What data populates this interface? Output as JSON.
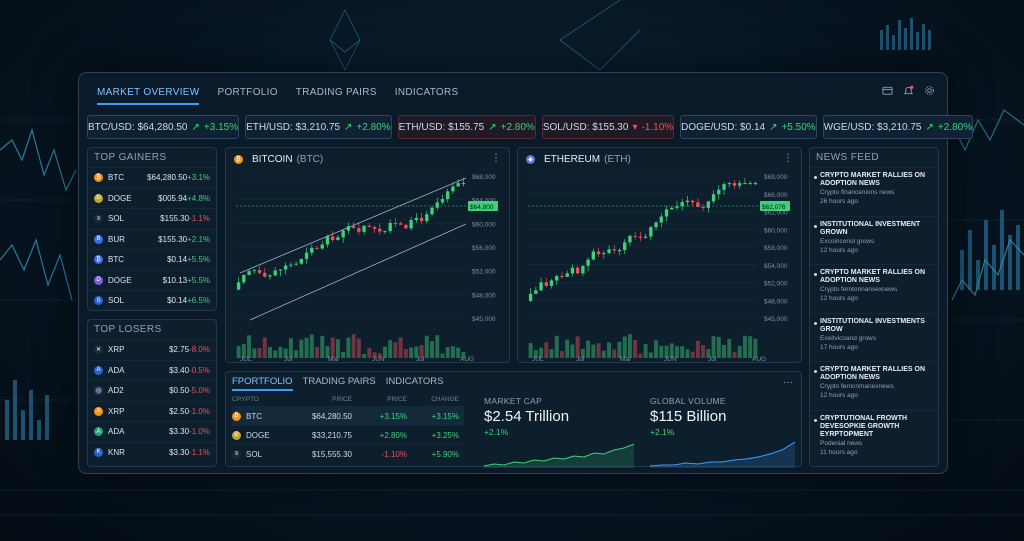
{
  "nav": {
    "tabs": [
      "MARKET OVERVIEW",
      "PORTFOLIO",
      "TRADING PAIRS",
      "INDICATORS"
    ],
    "icons": [
      "wallet-icon",
      "bell-icon",
      "gear-icon"
    ]
  },
  "tickers": [
    {
      "pair": "BTC/USD: $64,280.50",
      "change": "+3.15%",
      "direction": "up"
    },
    {
      "pair": "ETH/USD: $3,210.75",
      "change": "+2.80%",
      "direction": "up"
    },
    {
      "pair": "ETH/USD: $155.75",
      "change": "+2.80%",
      "direction": "up"
    },
    {
      "pair": "SOL/USD: $155.30",
      "change": "-1.10%",
      "direction": "down"
    },
    {
      "pair": "DOGE/USD: $0.14",
      "change": "+5.50%",
      "direction": "up"
    },
    {
      "pair": "WGE/USD: $3,210.75",
      "change": "+2.80%",
      "direction": "up"
    }
  ],
  "top_gainers": {
    "title": "TOP GAINERS",
    "rows": [
      {
        "sym": "BTC",
        "price": "$64,280.50",
        "change": "+3.1%",
        "color": "#f7931a",
        "glyph": "₿"
      },
      {
        "sym": "DOGE",
        "price": "$005.94",
        "change": "+4.8%",
        "color": "#c2a633",
        "glyph": "Ð"
      },
      {
        "sym": "SOL",
        "price": "$155.30",
        "change": "-1.1%",
        "color": "#1e2a3a",
        "glyph": "≡"
      },
      {
        "sym": "BUR",
        "price": "$155.30",
        "change": "+2.1%",
        "color": "#3a6ee8",
        "glyph": "B"
      },
      {
        "sym": "BTC",
        "price": "$0.14",
        "change": "+5.5%",
        "color": "#3a6ee8",
        "glyph": "₿"
      },
      {
        "sym": "DOGE",
        "price": "$10.13",
        "change": "+5.5%",
        "color": "#7a5ae0",
        "glyph": "D"
      },
      {
        "sym": "SOL",
        "price": "$0.14",
        "change": "+6.5%",
        "color": "#2a62c8",
        "glyph": "S"
      }
    ]
  },
  "top_losers": {
    "title": "TOP LOSERS",
    "rows": [
      {
        "sym": "XRP",
        "price": "$2.75",
        "change": "-8.0%",
        "color": "#1e2a3a",
        "glyph": "✕"
      },
      {
        "sym": "ADA",
        "price": "$3.40",
        "change": "-0.5%",
        "color": "#2a62c8",
        "glyph": "A"
      },
      {
        "sym": "AD2",
        "price": "$0.50",
        "change": "-5.0%",
        "color": "#2a3a5a",
        "glyph": "◎"
      },
      {
        "sym": "XRP",
        "price": "$2.50",
        "change": "-1.0%",
        "color": "#f7931a",
        "glyph": "X"
      },
      {
        "sym": "ADA",
        "price": "$3.30",
        "change": "-1.0%",
        "color": "#26a17b",
        "glyph": "A"
      },
      {
        "sym": "KNR",
        "price": "$3.30",
        "change": "-1.1%",
        "color": "#2a62c8",
        "glyph": "K"
      }
    ]
  },
  "btc_chart": {
    "name": "BITCOIN",
    "symbol": "(BTC)",
    "last_price": "$64,800",
    "y_ticks": [
      "$68,000",
      "$64,000",
      "$60,000",
      "$56,000",
      "$52,000",
      "$48,000",
      "$45,000"
    ],
    "x_ticks": [
      "JUL",
      "Jul",
      "Mar",
      "JUN",
      "Jul",
      "AUG"
    ]
  },
  "eth_chart": {
    "name": "ETHEREUM",
    "symbol": "(ETH)",
    "last_price": "$62,076",
    "y_ticks": [
      "$69,000",
      "$66,000",
      "$62,000",
      "$60,000",
      "$58,000",
      "$54,000",
      "$52,000",
      "$48,000",
      "$45,000"
    ],
    "x_ticks": [
      "JUL",
      "Jul",
      "Mar",
      "JUN",
      "Jul",
      "AUG"
    ]
  },
  "news": {
    "title": "NEWS FEED",
    "items": [
      {
        "headline": "CRYPTO MARKET RALLIES ON ADOPTION NEWS",
        "source": "Crypto financenions news",
        "time": "26 hours ago"
      },
      {
        "headline": "INSTITUTIONAL INVESTMENT GROWN",
        "source": "Excoinconol grows",
        "time": "12 hours ago"
      },
      {
        "headline": "CRYPTO MARKET RALLIES ON ADOPTION NEWS",
        "source": "Crypto ferntonnansexnews",
        "time": "12 hours ago"
      },
      {
        "headline": "INSTITUTIONAL INVESTMENTS GROW",
        "source": "Exeitvicoand grows",
        "time": "17 hours ago"
      },
      {
        "headline": "CRYPTO MARKET RALLIES ON ADOPTION NEWS",
        "source": "Crypto ferncnmanexnews",
        "time": "12 hours ago"
      },
      {
        "headline": "CRYPTUTIONAL FROWTH DEVESOPKIE GROWTH EYRPTOPMENT",
        "source": "Podenial news",
        "time": "11 hours ago"
      }
    ]
  },
  "bottom": {
    "tabs": [
      "FPORTFOLIO",
      "TRADING PAIRS",
      "INDICATORS"
    ],
    "table_headers": [
      "CRYPTO",
      "PRICE",
      "PRICE",
      "CHANGE"
    ],
    "rows": [
      {
        "sym": "BTC",
        "price": "$64,280.50",
        "price2": "+3.15%",
        "change": "+3.15%",
        "color": "#f7931a",
        "glyph": "₿",
        "dir2": "up"
      },
      {
        "sym": "DOGE",
        "price": "$33,210.75",
        "price2": "+2.80%",
        "change": "+3.25%",
        "color": "#c2a633",
        "glyph": "Ð",
        "dir2": "up"
      },
      {
        "sym": "SOL",
        "price": "$15,555.30",
        "price2": "-1.10%",
        "change": "+5.90%",
        "color": "#1e2a3a",
        "glyph": "≡",
        "dir2": "down"
      }
    ],
    "market_cap": {
      "label": "MARKET CAP",
      "value": "$2.54 Trillion",
      "change": "+2.1%"
    },
    "global_volume": {
      "label": "GLOBAL VOLUME",
      "value": "$115 Billion",
      "change": "+2.1%"
    }
  },
  "colors": {
    "accent": "#3c9dff",
    "up": "#3fd17a",
    "down": "#ef4f5a"
  }
}
